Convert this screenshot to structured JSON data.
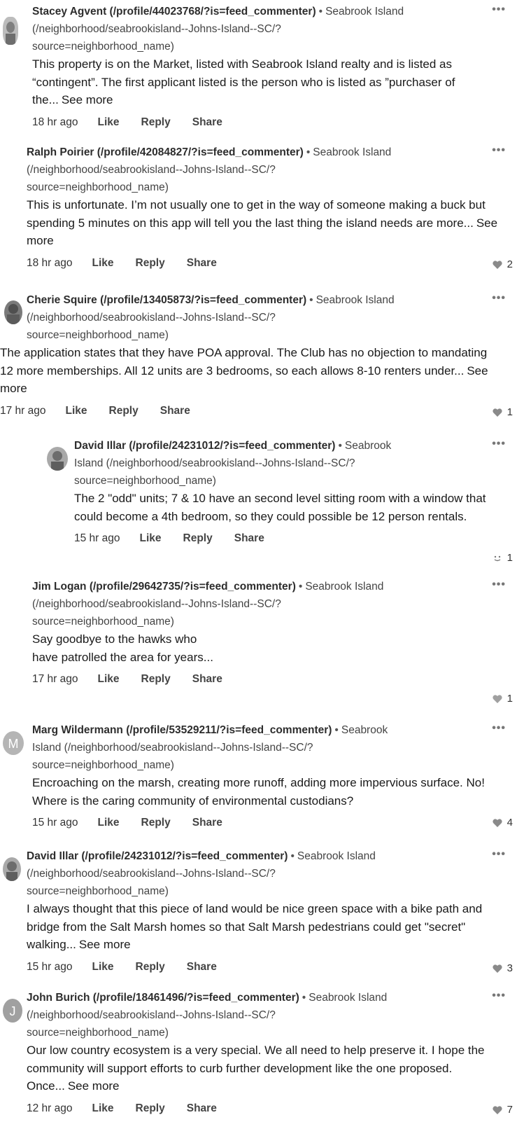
{
  "more_label": "•••",
  "actions": {
    "like": "Like",
    "reply": "Reply",
    "share": "Share"
  },
  "comments": [
    {
      "author": "Stacey Agvent (/profile/44023768/?is=feed_commenter)",
      "hood_a": "Seabrook Island",
      "hood_b": "(/neighborhood/seabrookisland--Johns-Island--SC/?",
      "hood_c": "source=neighborhood_name)",
      "text": "This property is on the Market, listed with Seabrook Island realty and is listed as “contingent”. The first applicant listed is the person who is listed as ”purchaser of the...",
      "see_more": "See more",
      "time": "18 hr ago",
      "reaction_count": ""
    },
    {
      "author": "Ralph Poirier (/profile/42084827/?is=feed_commenter)",
      "hood_a": "Seabrook Island",
      "hood_b": "(/neighborhood/seabrookisland--Johns-Island--SC/?",
      "hood_c": "source=neighborhood_name)",
      "text": "This is unfortunate. I’m not usually one to get in the way of someone making a buck but spending 5 minutes on this app will tell you the last thing the island needs are more...",
      "see_more": "See more",
      "time": "18 hr ago",
      "reaction_count": "2"
    },
    {
      "author": "Cherie Squire (/profile/13405873/?is=feed_commenter)",
      "hood_a": "Seabrook Island",
      "hood_b": "(/neighborhood/seabrookisland--Johns-Island--SC/?",
      "hood_c": "source=neighborhood_name)",
      "text": "The application states that they have POA approval. The Club has no objection to mandating 12 more memberships. All 12 units are 3 bedrooms, so each allows 8-10 renters under...",
      "see_more": "See more",
      "time": "17 hr ago",
      "reaction_count": "1"
    },
    {
      "author": "David Illar (/profile/24231012/?is=feed_commenter)",
      "hood_a": "Seabrook",
      "hood_b": "Island (/neighborhood/seabrookisland--Johns-Island--SC/?",
      "hood_c": "source=neighborhood_name)",
      "text": "The 2 \"odd\" units; 7 & 10 have an second level sitting room with a window that could become a 4th bedroom, so they could possible be 12 person rentals.",
      "see_more": "",
      "time": "15 hr ago",
      "reaction_count": "1"
    },
    {
      "author": "Jim Logan (/profile/29642735/?is=feed_commenter)",
      "hood_a": "Seabrook Island",
      "hood_b": "(/neighborhood/seabrookisland--Johns-Island--SC/?",
      "hood_c": "source=neighborhood_name)",
      "text_line1": "Say goodbye to the hawks who",
      "text_line2": "have patrolled the area for years...",
      "time": "17 hr ago",
      "reaction_count": "1"
    },
    {
      "author": "Marg Wildermann (/profile/53529211/?is=feed_commenter)",
      "hood_a": "Seabrook",
      "hood_b": "Island (/neighborhood/seabrookisland--Johns-Island--SC/?",
      "hood_c": "source=neighborhood_name)",
      "text": "Encroaching on the marsh, creating more runoff, adding more impervious surface. No!  Where is the caring community of environmental custodians?",
      "see_more": "",
      "time": "15 hr ago",
      "reaction_count": "4"
    },
    {
      "author": "David Illar (/profile/24231012/?is=feed_commenter)",
      "hood_a": "Seabrook Island",
      "hood_b": "(/neighborhood/seabrookisland--Johns-Island--SC/?",
      "hood_c": "source=neighborhood_name)",
      "text": "I always thought that this piece of land would be nice green space with a bike path and bridge from the Salt Marsh homes so that Salt Marsh pedestrians could get \"secret\" walking...",
      "see_more": "See more",
      "time": "15 hr ago",
      "reaction_count": "3"
    },
    {
      "author": "John Burich (/profile/18461496/?is=feed_commenter)",
      "hood_a": "Seabrook Island",
      "hood_b": "(/neighborhood/seabrookisland--Johns-Island--SC/?",
      "hood_c": "source=neighborhood_name)",
      "text": "Our low country ecosystem is a very special. We all need to help preserve it. I hope the community will support efforts to curb further development like the one proposed. Once...",
      "see_more": "See more",
      "time": "12 hr ago",
      "reaction_count": "7"
    }
  ],
  "colors": {
    "text": "#1a1a1a",
    "meta": "#444444",
    "icon": "#777777"
  }
}
